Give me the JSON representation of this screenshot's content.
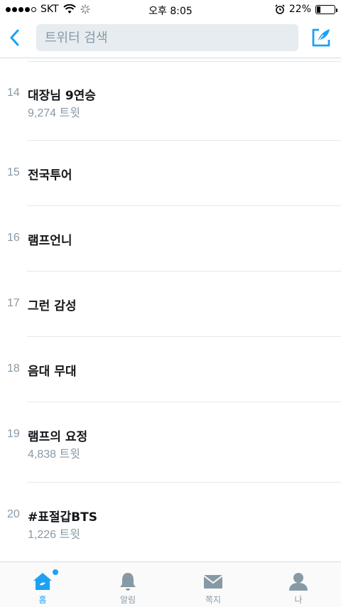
{
  "status_bar": {
    "carrier": "SKT",
    "time": "오후 8:05",
    "battery": "22%",
    "battery_level": 0.22
  },
  "nav": {
    "search_placeholder": "트위터 검색"
  },
  "trends": [
    {
      "rank": "14",
      "name": "대장님 9연승",
      "count": "9,274 트윗"
    },
    {
      "rank": "15",
      "name": "전국투어",
      "count": ""
    },
    {
      "rank": "16",
      "name": "램프언니",
      "count": ""
    },
    {
      "rank": "17",
      "name": "그런 감성",
      "count": ""
    },
    {
      "rank": "18",
      "name": "음대 무대",
      "count": ""
    },
    {
      "rank": "19",
      "name": "램프의 요정",
      "count": "4,838 트윗"
    },
    {
      "rank": "20",
      "name": "#표절갑BTS",
      "count": "1,226 트윗"
    }
  ],
  "tabs": [
    {
      "label": "홈",
      "icon": "home-icon",
      "active": true
    },
    {
      "label": "알림",
      "icon": "bell-icon",
      "active": false
    },
    {
      "label": "쪽지",
      "icon": "envelope-icon",
      "active": false
    },
    {
      "label": "나",
      "icon": "person-icon",
      "active": false
    }
  ],
  "colors": {
    "accent": "#1da1f2",
    "muted": "#8899a6"
  }
}
